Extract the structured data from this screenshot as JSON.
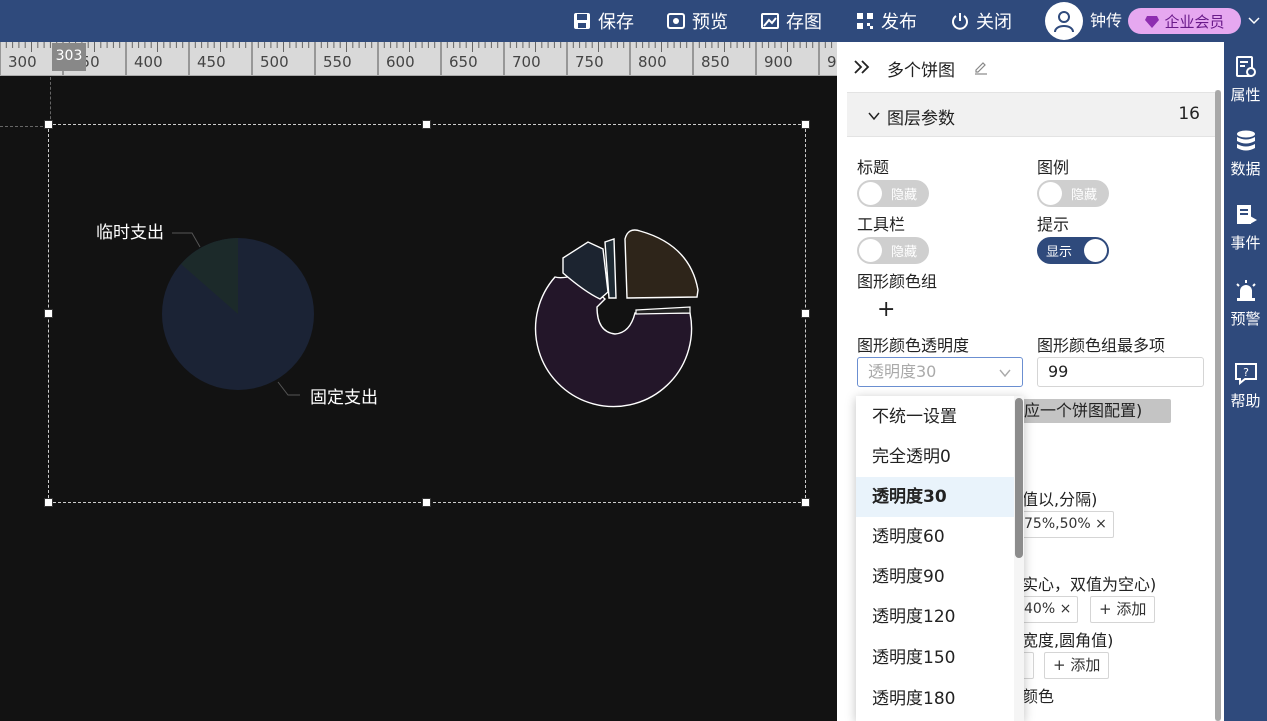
{
  "topbar": {
    "save": "保存",
    "preview": "预览",
    "save_image": "存图",
    "publish": "发布",
    "close": "关闭",
    "username": "钟传",
    "vip_label": "企业会员"
  },
  "ruler": {
    "marker": "303",
    "ticks": [
      "300",
      "350",
      "400",
      "450",
      "500",
      "550",
      "600",
      "650",
      "700",
      "750",
      "800",
      "850",
      "900",
      "9"
    ]
  },
  "canvas_chart": {
    "labels": [
      "临时支出",
      "固定支出"
    ]
  },
  "panel": {
    "title": "多个饼图",
    "section": "图层参数",
    "section_count": "16",
    "title_label": "标题",
    "legend_label": "图例",
    "toolbar_label": "工具栏",
    "tooltip_label": "提示",
    "hidden_text": "隐藏",
    "shown_text": "显示",
    "color_group_label": "图形颜色组",
    "add_symbol": "+",
    "opacity_label": "图形颜色透明度",
    "opacity_value": "透明度30",
    "max_items_label": "图形颜色组最多项",
    "max_items_value": "99",
    "pill_text": "应一个饼图配置)",
    "frag1": "值以,分隔)",
    "tag1": "75%,50% ×",
    "frag2": "实心，双值为空心)",
    "tag2": "40% ×",
    "add_label": "+ 添加",
    "frag3": "宽度,圆角值)",
    "frag4": "颜色"
  },
  "dropdown": {
    "items": [
      "不统一设置",
      "完全透明0",
      "透明度30",
      "透明度60",
      "透明度90",
      "透明度120",
      "透明度150",
      "透明度180"
    ],
    "selected": "透明度30"
  },
  "rightbar": {
    "items": [
      "属性",
      "数据",
      "事件",
      "预警",
      "帮助"
    ]
  },
  "colors": {
    "nav": "#2f4a7c",
    "vip": "#e6a8f0",
    "canvas": "#121212"
  }
}
